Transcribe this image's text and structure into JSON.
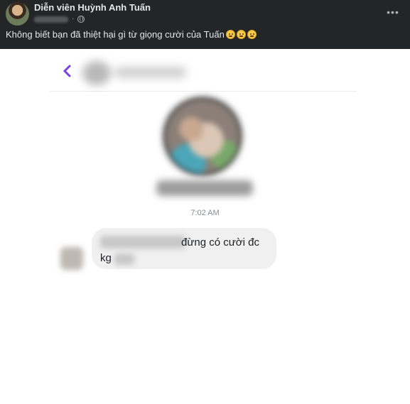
{
  "post": {
    "author": "Diễn viên Huỳnh Anh Tuấn",
    "caption": "Không biết bạn đã thiệt hại gì từ giọng cười của Tuấn",
    "icons": {
      "privacy": "globe-icon",
      "menu": "more-options-icon",
      "reactions": [
        "slight-smile-emoji",
        "slight-smile-emoji",
        "slight-smile-emoji"
      ]
    }
  },
  "chat": {
    "icons": {
      "back": "chevron-left-icon"
    },
    "accent_color": "#7b3fe4",
    "timestamp": "7:02 AM",
    "message": {
      "line1": "đừng có cười đc",
      "line2": "kg"
    }
  },
  "colors": {
    "header_bg": "#242526",
    "header_text": "#e4e6eb",
    "bubble_bg": "#f0f0f0"
  }
}
